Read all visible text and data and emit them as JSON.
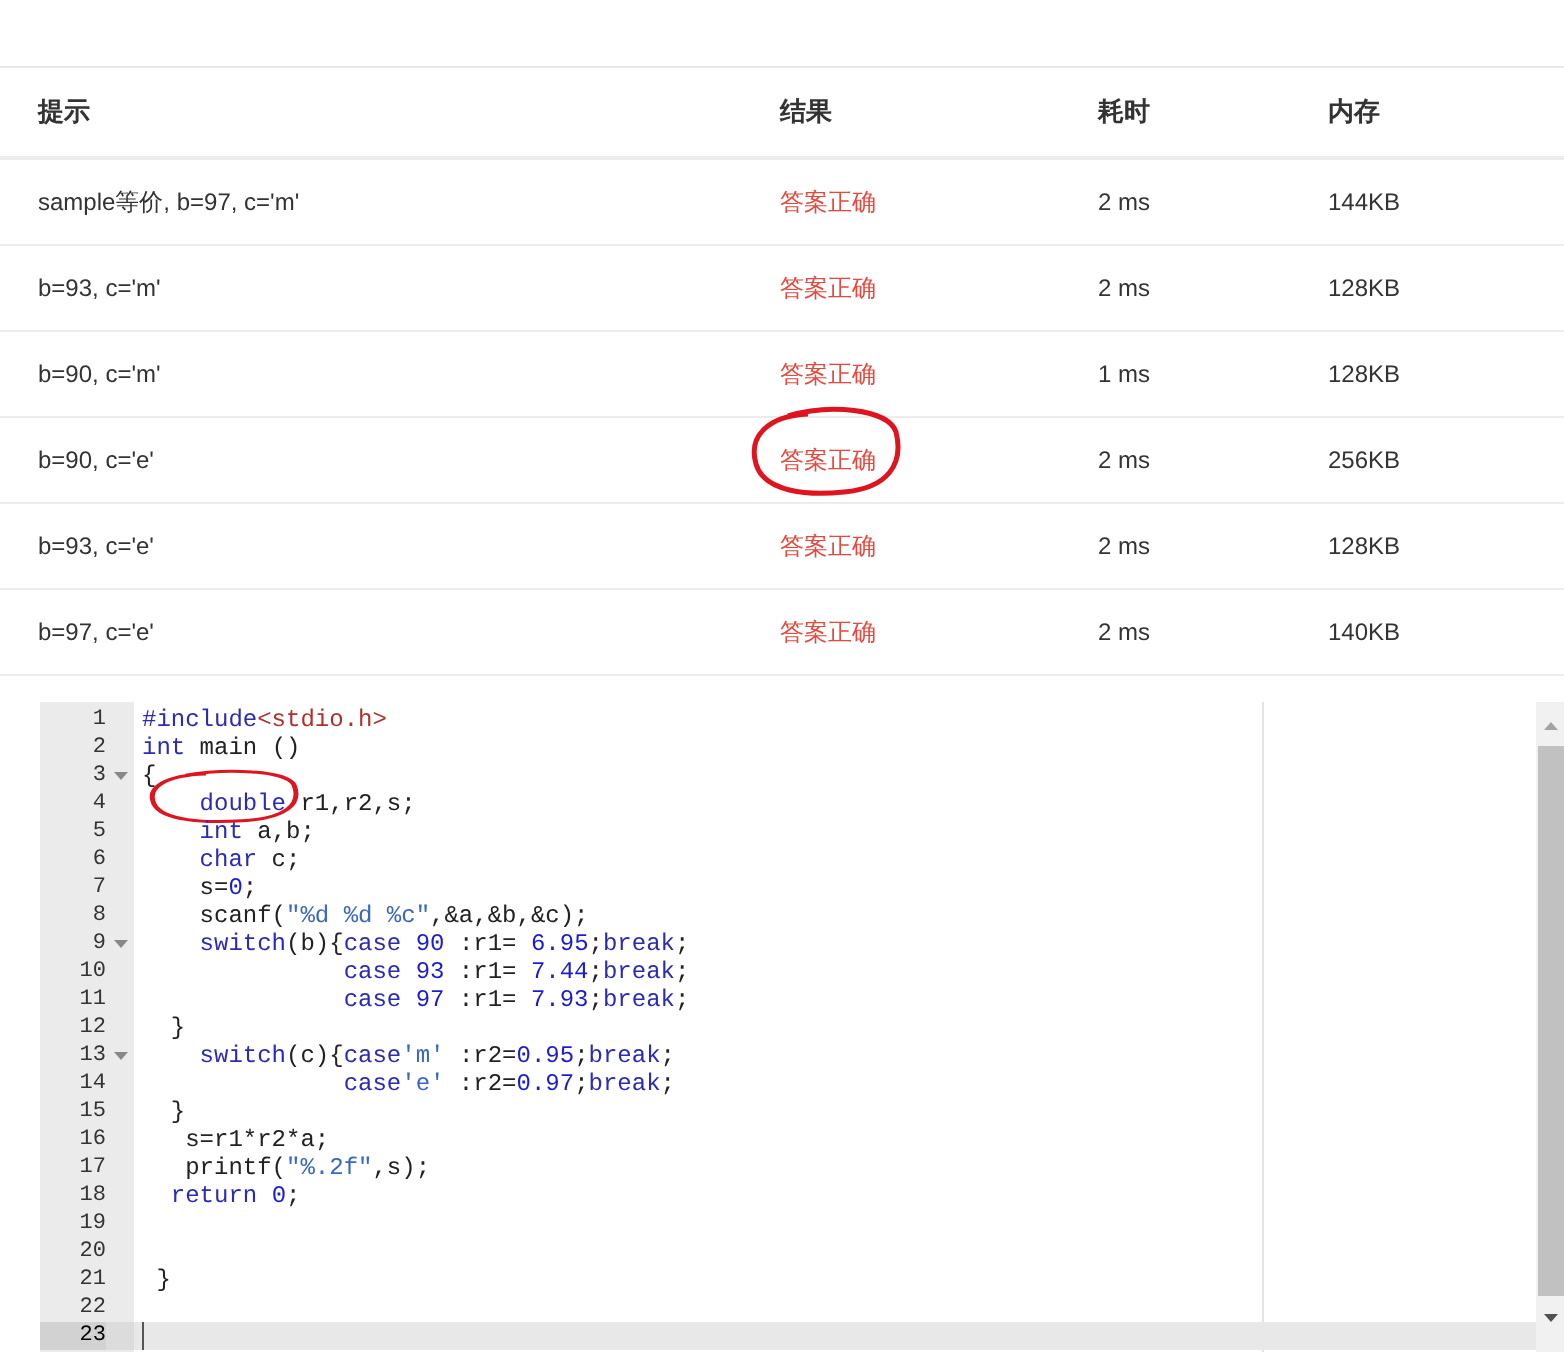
{
  "table": {
    "columns": [
      "提示",
      "结果",
      "耗时",
      "内存"
    ],
    "rows": [
      {
        "hint": "sample等价, b=97, c='m'",
        "result": "答案正确",
        "time": "2 ms",
        "memory": "144KB",
        "circled": false
      },
      {
        "hint": "b=93, c='m'",
        "result": "答案正确",
        "time": "2 ms",
        "memory": "128KB",
        "circled": false
      },
      {
        "hint": "b=90, c='m'",
        "result": "答案正确",
        "time": "1 ms",
        "memory": "128KB",
        "circled": false
      },
      {
        "hint": "b=90, c='e'",
        "result": "答案正确",
        "time": "2 ms",
        "memory": "256KB",
        "circled": true
      },
      {
        "hint": "b=93, c='e'",
        "result": "答案正确",
        "time": "2 ms",
        "memory": "128KB",
        "circled": false
      },
      {
        "hint": "b=97, c='e'",
        "result": "答案正确",
        "time": "2 ms",
        "memory": "140KB",
        "circled": false
      }
    ]
  },
  "editor": {
    "lines": [
      {
        "number": "1",
        "foldable": false,
        "active": false,
        "circled": false,
        "tokens": [
          {
            "text": "#include",
            "kind": "kw"
          },
          {
            "text": "<stdio.h>",
            "kind": "header"
          }
        ]
      },
      {
        "number": "2",
        "foldable": false,
        "active": false,
        "circled": false,
        "tokens": [
          {
            "text": "int",
            "kind": "kw"
          },
          {
            "text": " main ()",
            "kind": "plain"
          }
        ]
      },
      {
        "number": "3",
        "foldable": true,
        "active": false,
        "circled": false,
        "tokens": [
          {
            "text": "{",
            "kind": "plain"
          }
        ]
      },
      {
        "number": "4",
        "foldable": false,
        "active": false,
        "circled": true,
        "tokens": [
          {
            "text": "    double",
            "kind": "kw"
          },
          {
            "text": " r1,r2,s;",
            "kind": "plain"
          }
        ]
      },
      {
        "number": "5",
        "foldable": false,
        "active": false,
        "circled": false,
        "tokens": [
          {
            "text": "    int",
            "kind": "kw"
          },
          {
            "text": " a,b;",
            "kind": "plain"
          }
        ]
      },
      {
        "number": "6",
        "foldable": false,
        "active": false,
        "circled": false,
        "tokens": [
          {
            "text": "    char",
            "kind": "kw"
          },
          {
            "text": " c;",
            "kind": "plain"
          }
        ]
      },
      {
        "number": "7",
        "foldable": false,
        "active": false,
        "circled": false,
        "tokens": [
          {
            "text": "    s=",
            "kind": "plain"
          },
          {
            "text": "0",
            "kind": "num"
          },
          {
            "text": ";",
            "kind": "plain"
          }
        ]
      },
      {
        "number": "8",
        "foldable": false,
        "active": false,
        "circled": false,
        "tokens": [
          {
            "text": "    scanf(",
            "kind": "plain"
          },
          {
            "text": "\"%d %d %c\"",
            "kind": "str"
          },
          {
            "text": ",&a,&b,&c);",
            "kind": "plain"
          }
        ]
      },
      {
        "number": "9",
        "foldable": true,
        "active": false,
        "circled": false,
        "tokens": [
          {
            "text": "    switch",
            "kind": "kw"
          },
          {
            "text": "(b){",
            "kind": "plain"
          },
          {
            "text": "case ",
            "kind": "kw"
          },
          {
            "text": "90",
            "kind": "num"
          },
          {
            "text": " :r1= ",
            "kind": "plain"
          },
          {
            "text": "6.95",
            "kind": "num"
          },
          {
            "text": ";",
            "kind": "plain"
          },
          {
            "text": "break",
            "kind": "kw"
          },
          {
            "text": ";",
            "kind": "plain"
          }
        ]
      },
      {
        "number": "10",
        "foldable": false,
        "active": false,
        "circled": false,
        "tokens": [
          {
            "text": "              case ",
            "kind": "kw"
          },
          {
            "text": "93",
            "kind": "num"
          },
          {
            "text": " :r1= ",
            "kind": "plain"
          },
          {
            "text": "7.44",
            "kind": "num"
          },
          {
            "text": ";",
            "kind": "plain"
          },
          {
            "text": "break",
            "kind": "kw"
          },
          {
            "text": ";",
            "kind": "plain"
          }
        ]
      },
      {
        "number": "11",
        "foldable": false,
        "active": false,
        "circled": false,
        "tokens": [
          {
            "text": "              case ",
            "kind": "kw"
          },
          {
            "text": "97",
            "kind": "num"
          },
          {
            "text": " :r1= ",
            "kind": "plain"
          },
          {
            "text": "7.93",
            "kind": "num"
          },
          {
            "text": ";",
            "kind": "plain"
          },
          {
            "text": "break",
            "kind": "kw"
          },
          {
            "text": ";",
            "kind": "plain"
          }
        ]
      },
      {
        "number": "12",
        "foldable": false,
        "active": false,
        "circled": false,
        "tokens": [
          {
            "text": "  }",
            "kind": "plain"
          }
        ]
      },
      {
        "number": "13",
        "foldable": true,
        "active": false,
        "circled": false,
        "tokens": [
          {
            "text": "    switch",
            "kind": "kw"
          },
          {
            "text": "(c){",
            "kind": "plain"
          },
          {
            "text": "case",
            "kind": "kw"
          },
          {
            "text": "'m'",
            "kind": "str"
          },
          {
            "text": " :r2=",
            "kind": "plain"
          },
          {
            "text": "0.95",
            "kind": "num"
          },
          {
            "text": ";",
            "kind": "plain"
          },
          {
            "text": "break",
            "kind": "kw"
          },
          {
            "text": ";",
            "kind": "plain"
          }
        ]
      },
      {
        "number": "14",
        "foldable": false,
        "active": false,
        "circled": false,
        "tokens": [
          {
            "text": "              case",
            "kind": "kw"
          },
          {
            "text": "'e'",
            "kind": "str"
          },
          {
            "text": " :r2=",
            "kind": "plain"
          },
          {
            "text": "0.97",
            "kind": "num"
          },
          {
            "text": ";",
            "kind": "plain"
          },
          {
            "text": "break",
            "kind": "kw"
          },
          {
            "text": ";",
            "kind": "plain"
          }
        ]
      },
      {
        "number": "15",
        "foldable": false,
        "active": false,
        "circled": false,
        "tokens": [
          {
            "text": "  }",
            "kind": "plain"
          }
        ]
      },
      {
        "number": "16",
        "foldable": false,
        "active": false,
        "circled": false,
        "tokens": [
          {
            "text": "   s=r1*r2*a;",
            "kind": "plain"
          }
        ]
      },
      {
        "number": "17",
        "foldable": false,
        "active": false,
        "circled": false,
        "tokens": [
          {
            "text": "   printf(",
            "kind": "plain"
          },
          {
            "text": "\"%.2f\"",
            "kind": "str"
          },
          {
            "text": ",s);",
            "kind": "plain"
          }
        ]
      },
      {
        "number": "18",
        "foldable": false,
        "active": false,
        "circled": false,
        "tokens": [
          {
            "text": "  return ",
            "kind": "kw"
          },
          {
            "text": "0",
            "kind": "num"
          },
          {
            "text": ";",
            "kind": "plain"
          }
        ]
      },
      {
        "number": "19",
        "foldable": false,
        "active": false,
        "circled": false
      },
      {
        "number": "20",
        "foldable": false,
        "active": false,
        "circled": false
      },
      {
        "number": "21",
        "foldable": false,
        "active": false,
        "circled": false,
        "tokens": [
          {
            "text": " }",
            "kind": "plain"
          }
        ]
      },
      {
        "number": "22",
        "foldable": false,
        "active": false,
        "circled": false
      },
      {
        "number": "23",
        "foldable": false,
        "active": true,
        "circled": false
      }
    ]
  }
}
